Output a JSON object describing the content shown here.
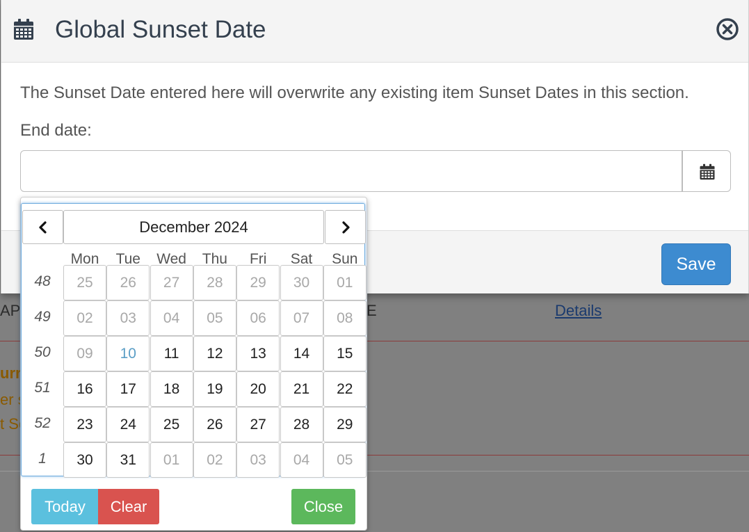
{
  "modal": {
    "title": "Global Sunset Date",
    "description": "The Sunset Date entered here will overwrite any existing item Sunset Dates in this section.",
    "end_date_label": "End date:",
    "end_date_value": "",
    "save_label": "Save"
  },
  "background": {
    "fragment_ap": "AP",
    "fragment_e": "E",
    "fragment_urr": "urr",
    "fragment_er_s": "er s",
    "fragment_t_sc": "t Sc",
    "details_link": "Details"
  },
  "datepicker": {
    "month_title": "December 2024",
    "weekdays": [
      "Mon",
      "Tue",
      "Wed",
      "Thu",
      "Fri",
      "Sat",
      "Sun"
    ],
    "weeks": [
      {
        "number": "48",
        "days": [
          {
            "label": "25",
            "state": "muted"
          },
          {
            "label": "26",
            "state": "muted"
          },
          {
            "label": "27",
            "state": "muted"
          },
          {
            "label": "28",
            "state": "muted"
          },
          {
            "label": "29",
            "state": "muted"
          },
          {
            "label": "30",
            "state": "muted"
          },
          {
            "label": "01",
            "state": "muted"
          }
        ]
      },
      {
        "number": "49",
        "days": [
          {
            "label": "02",
            "state": "muted"
          },
          {
            "label": "03",
            "state": "muted"
          },
          {
            "label": "04",
            "state": "muted"
          },
          {
            "label": "05",
            "state": "muted"
          },
          {
            "label": "06",
            "state": "muted"
          },
          {
            "label": "07",
            "state": "muted"
          },
          {
            "label": "08",
            "state": "muted"
          }
        ]
      },
      {
        "number": "50",
        "days": [
          {
            "label": "09",
            "state": "muted"
          },
          {
            "label": "10",
            "state": "today"
          },
          {
            "label": "11",
            "state": "active"
          },
          {
            "label": "12",
            "state": "active"
          },
          {
            "label": "13",
            "state": "active"
          },
          {
            "label": "14",
            "state": "active"
          },
          {
            "label": "15",
            "state": "active"
          }
        ]
      },
      {
        "number": "51",
        "days": [
          {
            "label": "16",
            "state": "active"
          },
          {
            "label": "17",
            "state": "active"
          },
          {
            "label": "18",
            "state": "active"
          },
          {
            "label": "19",
            "state": "active"
          },
          {
            "label": "20",
            "state": "active"
          },
          {
            "label": "21",
            "state": "active"
          },
          {
            "label": "22",
            "state": "active"
          }
        ]
      },
      {
        "number": "52",
        "days": [
          {
            "label": "23",
            "state": "active"
          },
          {
            "label": "24",
            "state": "active"
          },
          {
            "label": "25",
            "state": "active"
          },
          {
            "label": "26",
            "state": "active"
          },
          {
            "label": "27",
            "state": "active"
          },
          {
            "label": "28",
            "state": "active"
          },
          {
            "label": "29",
            "state": "active"
          }
        ]
      },
      {
        "number": "1",
        "days": [
          {
            "label": "30",
            "state": "active"
          },
          {
            "label": "31",
            "state": "active"
          },
          {
            "label": "01",
            "state": "muted"
          },
          {
            "label": "02",
            "state": "muted"
          },
          {
            "label": "03",
            "state": "muted"
          },
          {
            "label": "04",
            "state": "muted"
          },
          {
            "label": "05",
            "state": "muted"
          }
        ]
      }
    ],
    "today_label": "Today",
    "clear_label": "Clear",
    "close_label": "Close"
  },
  "icons": {
    "header": "calendar-icon",
    "close": "close-circle-icon",
    "input_addon": "calendar-icon",
    "prev": "chevron-left-icon",
    "next": "chevron-right-icon"
  },
  "colors": {
    "save": "#3d8bd0",
    "today_button": "#5bc0de",
    "clear_button": "#d9534f",
    "close_button": "#5cb85c",
    "today_date": "#5b9ec6"
  }
}
